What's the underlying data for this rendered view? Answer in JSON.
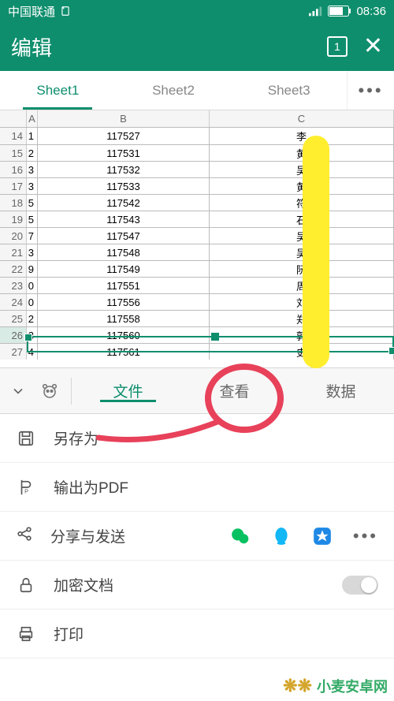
{
  "status": {
    "carrier": "中国联通",
    "time": "08:36"
  },
  "header": {
    "title": "编辑",
    "tabs_badge": "1"
  },
  "sheets": {
    "items": [
      {
        "label": "Sheet1",
        "active": true
      },
      {
        "label": "Sheet2",
        "active": false
      },
      {
        "label": "Sheet3",
        "active": false
      }
    ],
    "more": "•••"
  },
  "grid": {
    "cols": [
      "A",
      "B",
      "C"
    ],
    "selected_row": 26,
    "rows": [
      {
        "n": 14,
        "a": "1",
        "b": "117527",
        "c": "李"
      },
      {
        "n": 15,
        "a": "2",
        "b": "117531",
        "c": "黄"
      },
      {
        "n": 16,
        "a": "3",
        "b": "117532",
        "c": "吴"
      },
      {
        "n": 17,
        "a": "3",
        "b": "117533",
        "c": "黄"
      },
      {
        "n": 18,
        "a": "5",
        "b": "117542",
        "c": "符"
      },
      {
        "n": 19,
        "a": "5",
        "b": "117543",
        "c": "石"
      },
      {
        "n": 20,
        "a": "7",
        "b": "117547",
        "c": "吴"
      },
      {
        "n": 21,
        "a": "3",
        "b": "117548",
        "c": "吴"
      },
      {
        "n": 22,
        "a": "9",
        "b": "117549",
        "c": "阮"
      },
      {
        "n": 23,
        "a": "0",
        "b": "117551",
        "c": "周"
      },
      {
        "n": 24,
        "a": "0",
        "b": "117556",
        "c": "刘"
      },
      {
        "n": 25,
        "a": "2",
        "b": "117558",
        "c": "郑"
      },
      {
        "n": 26,
        "a": "3",
        "b": "117560",
        "c": "郭"
      },
      {
        "n": 27,
        "a": "4",
        "b": "117561",
        "c": "史"
      }
    ]
  },
  "tooltabs": {
    "items": [
      {
        "label": "文件",
        "active": true
      },
      {
        "label": "查看",
        "active": false
      },
      {
        "label": "数据",
        "active": false
      }
    ]
  },
  "menu": {
    "save_as": "另存为",
    "export_pdf": "输出为PDF",
    "share": "分享与发送",
    "encrypt": "加密文档",
    "print": "打印",
    "more": "•••"
  },
  "share_icons": {
    "wechat": "#07c160",
    "qq": "#12b7f5",
    "star": "#1e88e5"
  },
  "watermark": "小麦安卓网"
}
